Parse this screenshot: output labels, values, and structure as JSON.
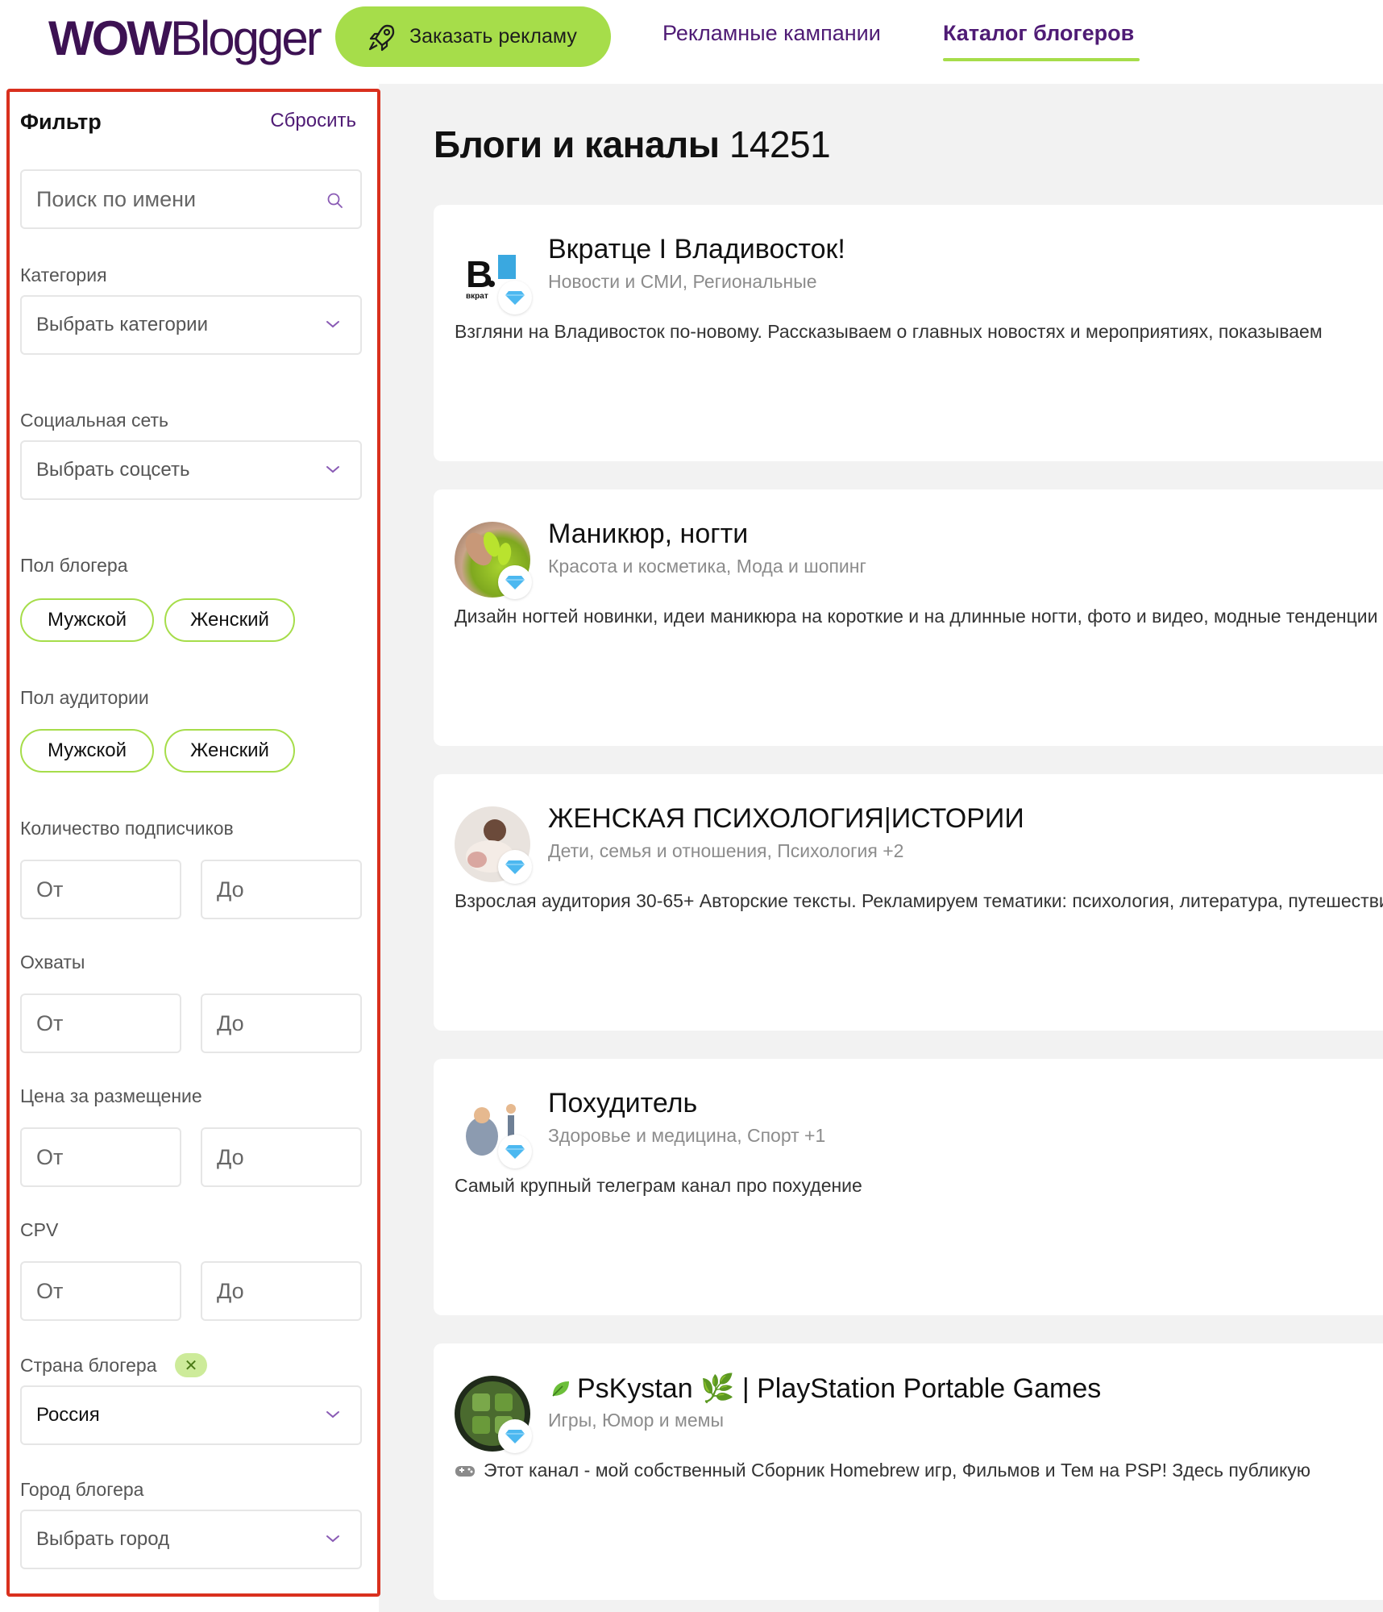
{
  "header": {
    "logo_bold": "WOW",
    "logo_light": "Blogger",
    "order_button": "Заказать рекламу",
    "nav": [
      "Рекламные кампании",
      "Каталог блогеров"
    ]
  },
  "sidebar": {
    "title": "Фильтр",
    "reset": "Сбросить",
    "search_placeholder": "Поиск по имени",
    "category_label": "Категория",
    "category_placeholder": "Выбрать категории",
    "social_label": "Социальная сеть",
    "social_placeholder": "Выбрать соцсеть",
    "blogger_gender_label": "Пол блогера",
    "audience_gender_label": "Пол аудитории",
    "gender_male": "Мужской",
    "gender_female": "Женский",
    "subscribers_label": "Количество подписчиков",
    "reach_label": "Охваты",
    "price_label": "Цена за размещение",
    "cpv_label": "CPV",
    "from": "От",
    "to": "До",
    "country_label": "Страна блогера",
    "country_value": "Россия",
    "city_label": "Город блогера",
    "city_placeholder": "Выбрать город"
  },
  "main": {
    "title": "Блоги и каналы",
    "count": "14251",
    "cards": [
      {
        "name": "Вкратце I Владивосток!",
        "cats": "Новости и СМИ,  Региональные",
        "desc": "Взгляни на Владивосток по-новому. Рассказываем о главных новостях и мероприятиях, показываем"
      },
      {
        "name": "Маникюр, ногти",
        "cats": "Красота и косметика,  Мода и шопинг",
        "desc": "Дизайн ногтей новинки, идеи маникюра на короткие и на длинные ногти, фото и видео, модные тенденции"
      },
      {
        "name": "ЖЕНСКАЯ ПСИХОЛОГИЯ|ИСТОРИИ",
        "cats": "Дети, семья и отношения,  Психология   +2",
        "desc": "Взрослая аудитория 30-65+ Авторские тексты. Рекламируем тематики: психология, литература, путешествия"
      },
      {
        "name": "Похудитель",
        "cats": "Здоровье и медицина,  Спорт   +1",
        "desc": "Самый крупный телеграм канал про похудение"
      },
      {
        "name": "PsKystan 🌿 | PlayStation Portable Games",
        "cats": "Игры,  Юмор и мемы",
        "desc": "Этот канал - мой собственный Сборник Homebrew игр, Фильмов и Тем на PSP! Здесь публикую"
      }
    ]
  },
  "colors": {
    "accent_green": "#a6dd4a",
    "brand_purple": "#4f1b75",
    "highlight_red": "#d9301e"
  }
}
